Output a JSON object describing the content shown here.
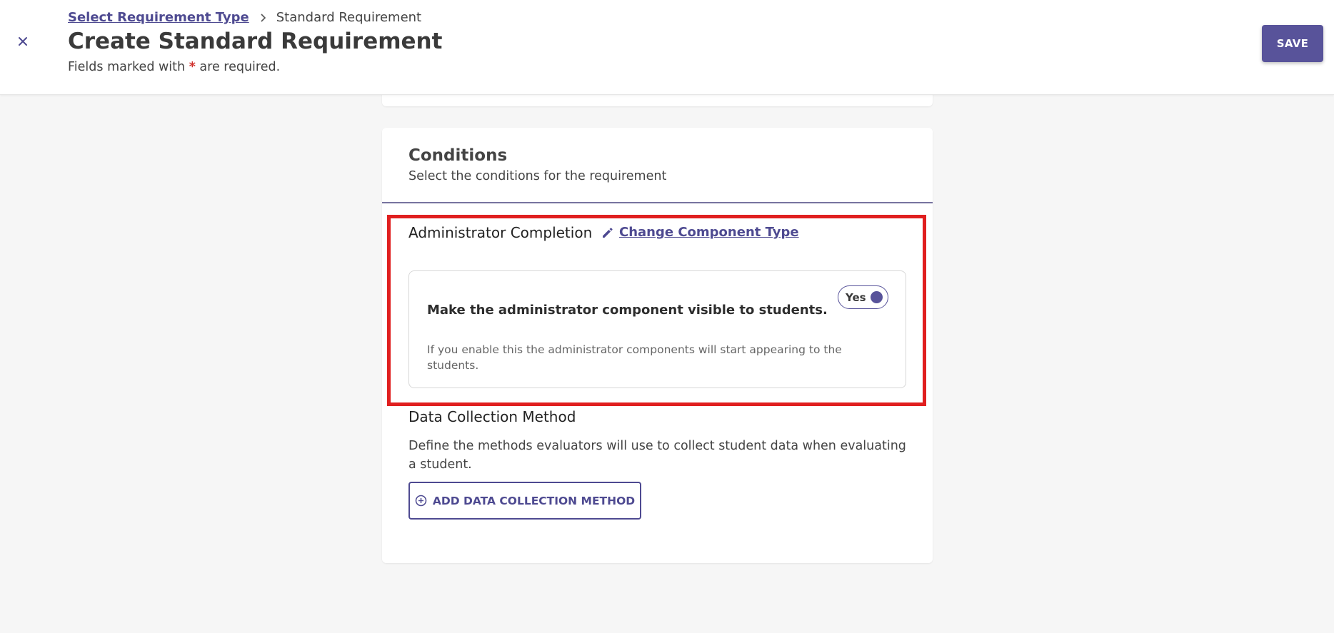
{
  "header": {
    "breadcrumb": {
      "link_label": "Select Requirement Type",
      "current_label": "Standard Requirement"
    },
    "title": "Create Standard Requirement",
    "required_note_prefix": "Fields marked with ",
    "required_star": "*",
    "required_note_suffix": " are required.",
    "save_label": "SAVE"
  },
  "conditions": {
    "title": "Conditions",
    "subtitle": "Select the conditions for the requirement",
    "component": {
      "title": "Administrator Completion",
      "change_label": "Change Component Type",
      "visibility": {
        "title": "Make the administrator component visible to students.",
        "description": "If you enable this the administrator components will start appearing to the students.",
        "toggle_label": "Yes",
        "toggle_on": true
      }
    },
    "data_collection": {
      "title": "Data Collection Method",
      "description": "Define the methods evaluators will use to collect student data when evaluating a student.",
      "add_label": "ADD DATA COLLECTION METHOD"
    }
  },
  "colors": {
    "accent": "#58539a",
    "link": "#4e4a91",
    "highlight": "#e01f1f",
    "required": "#d0312d",
    "background": "#f6f6f6"
  },
  "icons": {
    "close": "close-icon",
    "breadcrumb_separator": "chevron-right-icon",
    "change_component": "pencil-icon",
    "add": "add-circle-icon"
  }
}
